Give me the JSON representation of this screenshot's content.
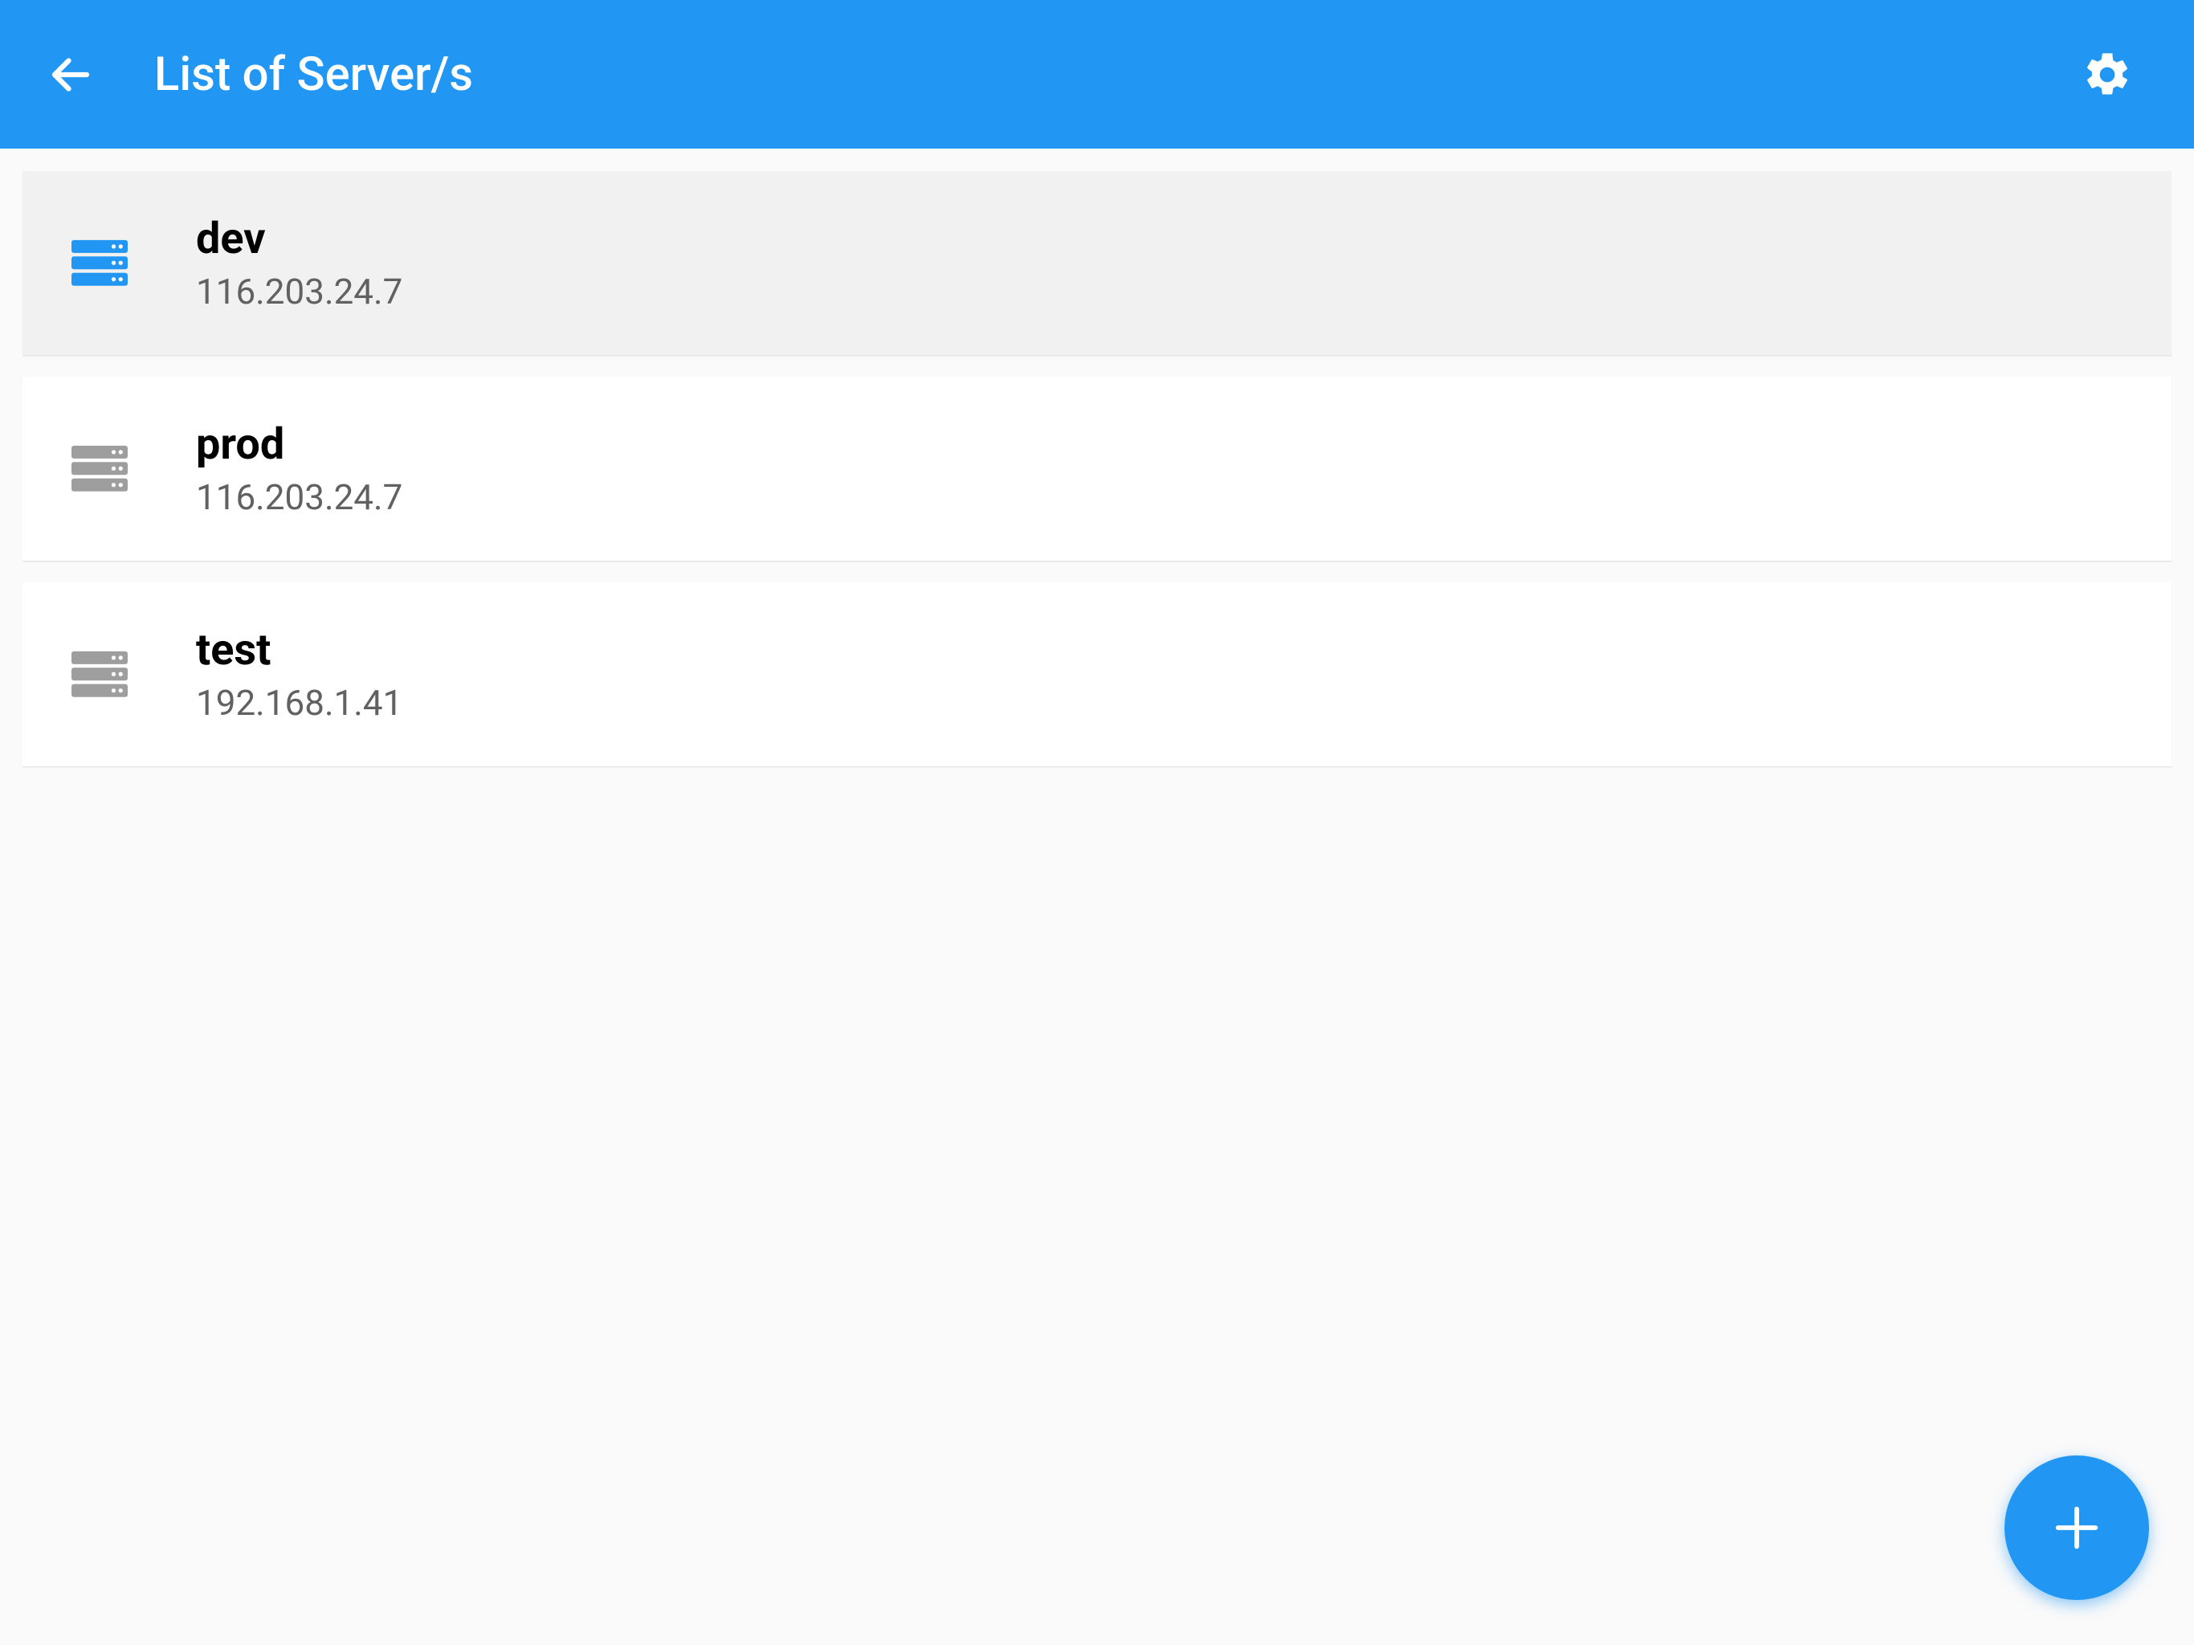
{
  "header": {
    "title": "List of Server/s"
  },
  "colors": {
    "primary": "#2196f3",
    "icon_inactive": "#9e9e9e",
    "icon_active": "#2196f3"
  },
  "servers": [
    {
      "name": "dev",
      "address": "116.203.24.7",
      "selected": true
    },
    {
      "name": "prod",
      "address": "116.203.24.7",
      "selected": false
    },
    {
      "name": "test",
      "address": "192.168.1.41",
      "selected": false
    }
  ]
}
